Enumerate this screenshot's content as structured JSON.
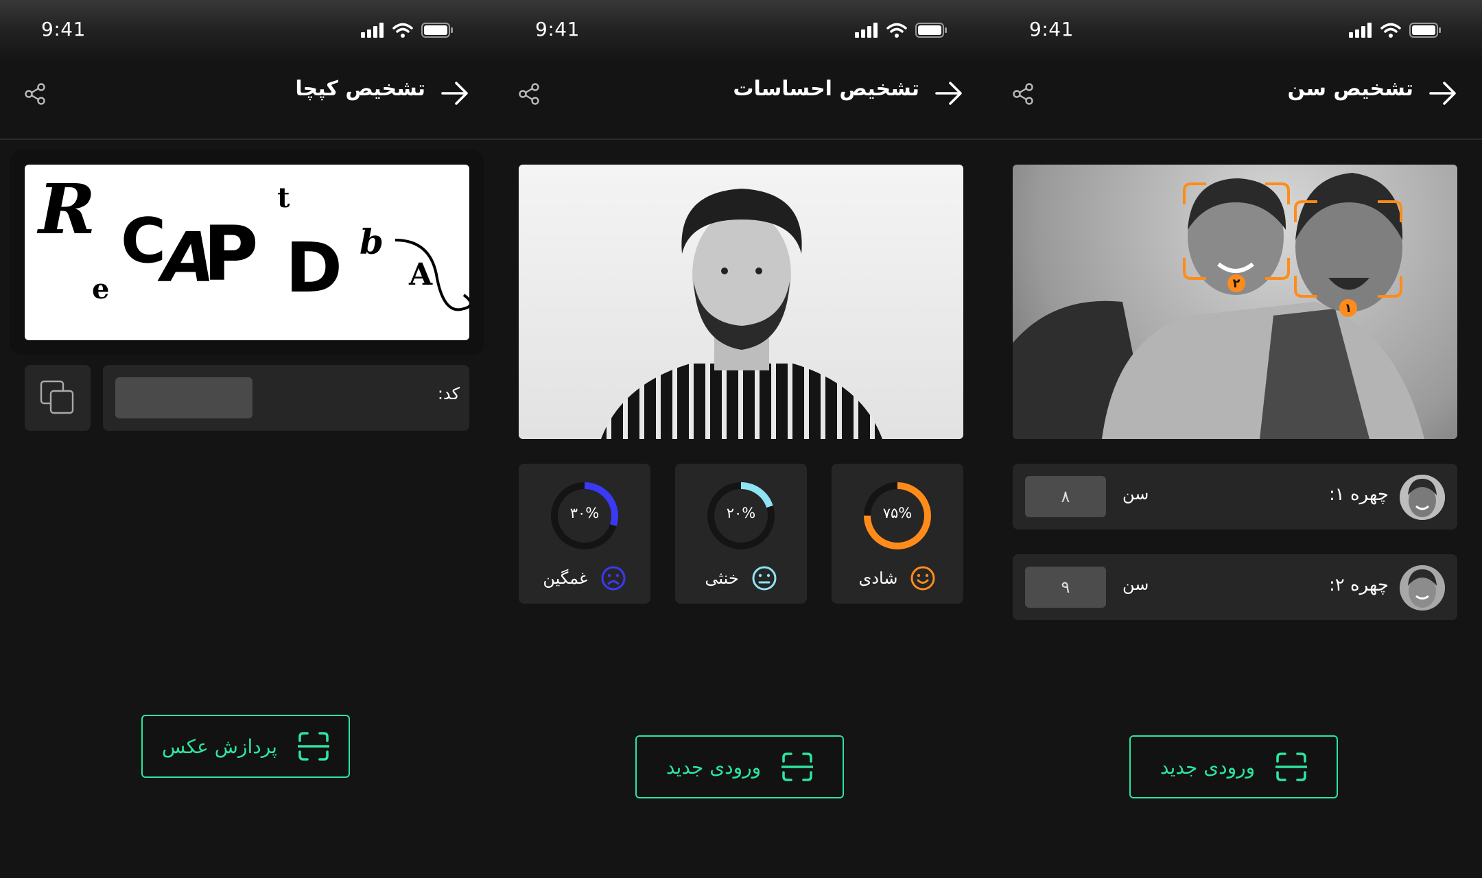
{
  "status_bar": {
    "time": "9:41"
  },
  "colors": {
    "accent_green": "#2ee5a0",
    "happy_orange": "#ff8c1a",
    "neutral_cyan": "#8fe3f5",
    "sad_blue": "#3a3af5",
    "background": "#141414",
    "card": "#262626"
  },
  "captcha_screen": {
    "title": "تشخیص کپچا",
    "captcha_text": "ReCAPtDbA",
    "code_label": "کد:",
    "code_value": "",
    "action_label": "پردازش عکس",
    "icons": [
      "share-icon",
      "arrow-right-icon",
      "copy-icon",
      "scan-icon"
    ]
  },
  "emotion_screen": {
    "title": "تشخیص احساسات",
    "emotions": [
      {
        "label": "شادی",
        "percent_text": "۷۵%",
        "value": 0.75,
        "icon": "smile-icon",
        "color": "#ff8c1a"
      },
      {
        "label": "خنثی",
        "percent_text": "۲۰%",
        "value": 0.2,
        "icon": "neutral-face-icon",
        "color": "#8fe3f5"
      },
      {
        "label": "غمگین",
        "percent_text": "۳۰%",
        "value": 0.3,
        "icon": "sad-face-icon",
        "color": "#3a3af5"
      }
    ],
    "action_label": "ورودی جدید"
  },
  "age_screen": {
    "title": "تشخیص سن",
    "faces": [
      {
        "label": "چهره ۱:",
        "age_label": "سن",
        "age_value": "۸",
        "marker": "۱"
      },
      {
        "label": "چهره ۲:",
        "age_label": "سن",
        "age_value": "۹",
        "marker": "۲"
      }
    ],
    "action_label": "ورودی جدید"
  }
}
